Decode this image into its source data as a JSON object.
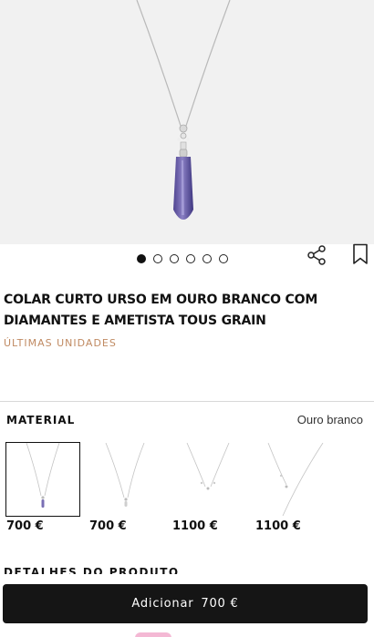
{
  "product": {
    "title": "COLAR CURTO URSO EM OURO BRANCO COM DIAMANTES E AMETISTA TOUS GRAIN",
    "badge": "ÚLTIMAS UNIDADES"
  },
  "gallery": {
    "image_count": 6,
    "active_index": 0
  },
  "icons": {
    "share": "share-icon",
    "bookmark": "bookmark-icon",
    "pendant_color": "#6c5fa8"
  },
  "material": {
    "label": "MATERIAL",
    "value": "Ouro branco",
    "variants": [
      {
        "price": "700 €",
        "selected": true
      },
      {
        "price": "700 €",
        "selected": false
      },
      {
        "price": "1100 €",
        "selected": false
      },
      {
        "price": "1100 €",
        "selected": false
      }
    ]
  },
  "details": {
    "heading": "DETALHES DO PRODUTO"
  },
  "cta": {
    "label": "Adicionar",
    "price": "700 €"
  }
}
